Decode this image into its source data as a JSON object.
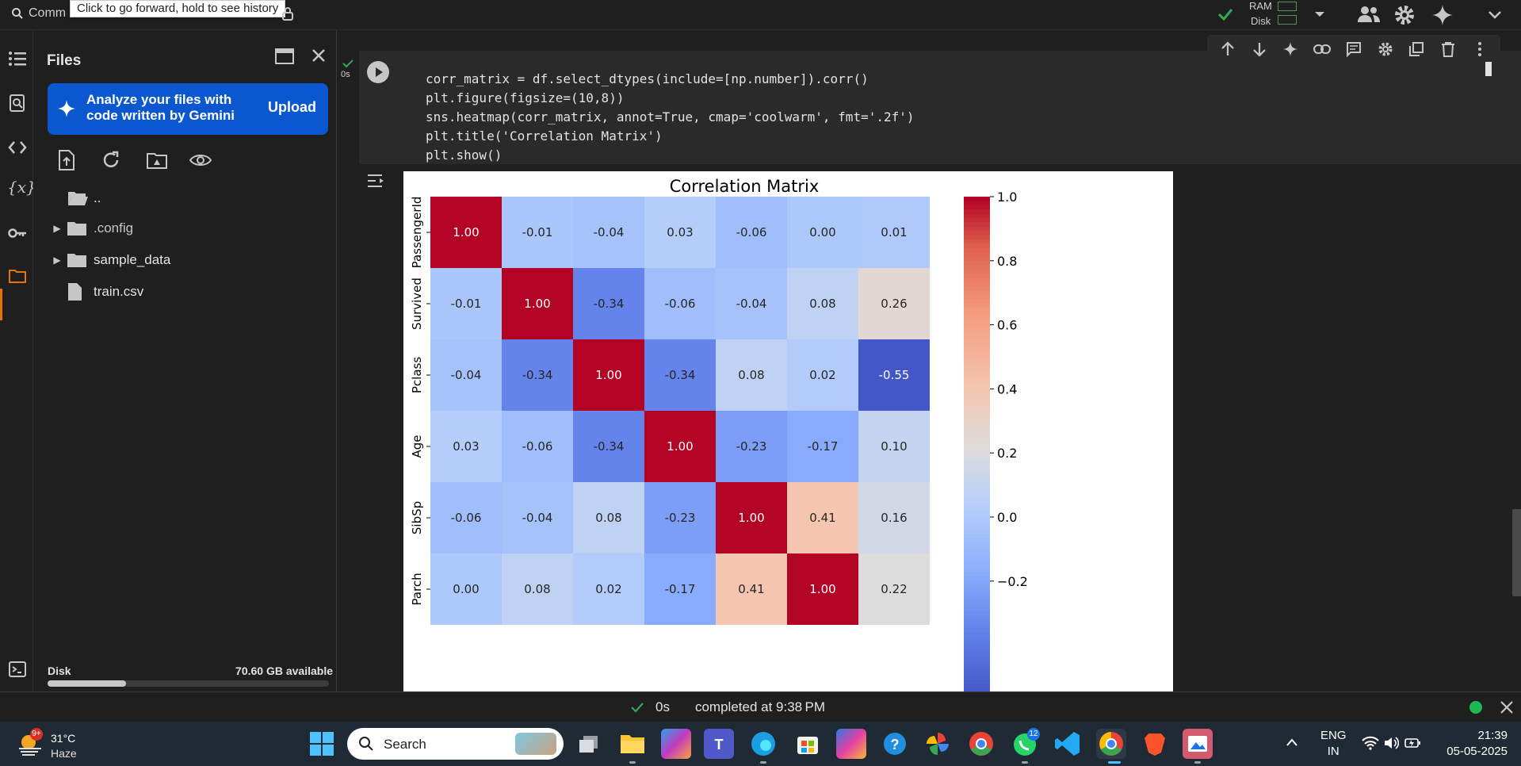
{
  "topbar": {
    "search_label": "Comm",
    "tooltip": "Click to go forward, hold to see history",
    "ram_label": "RAM",
    "disk_label": "Disk"
  },
  "files_panel": {
    "title": "Files",
    "gemini_text": "Analyze your files with code written by Gemini",
    "upload_label": "Upload",
    "tree": [
      {
        "name": "..",
        "type": "folder-open"
      },
      {
        "name": ".config",
        "type": "folder"
      },
      {
        "name": "sample_data",
        "type": "folder"
      },
      {
        "name": "train.csv",
        "type": "file"
      }
    ],
    "disk_label": "Disk",
    "disk_available": "70.60 GB available",
    "disk_used_fraction": 0.28
  },
  "cell": {
    "exec_time": "0s",
    "code_lines": [
      "corr_matrix = df.select_dtypes(include=[np.number]).corr()",
      "plt.figure(figsize=(10,8))",
      "sns.heatmap(corr_matrix, annot=True, cmap='coolwarm', fmt='.2f')",
      "plt.title('Correlation Matrix')",
      "plt.show()"
    ]
  },
  "chart_data": {
    "type": "heatmap",
    "title": "Correlation Matrix",
    "row_labels": [
      "PassengerId",
      "Survived",
      "Pclass",
      "Age",
      "SibSp",
      "Parch"
    ],
    "values": [
      [
        1.0,
        -0.01,
        -0.04,
        0.03,
        -0.06,
        -0.0,
        0.01
      ],
      [
        -0.01,
        1.0,
        -0.34,
        -0.06,
        -0.04,
        0.08,
        0.26
      ],
      [
        -0.04,
        -0.34,
        1.0,
        -0.34,
        0.08,
        0.02,
        -0.55
      ],
      [
        0.03,
        -0.06,
        -0.34,
        1.0,
        -0.23,
        -0.17,
        0.1
      ],
      [
        -0.06,
        -0.04,
        0.08,
        -0.23,
        1.0,
        0.41,
        0.16
      ],
      [
        -0.0,
        0.08,
        0.02,
        -0.17,
        0.41,
        1.0,
        0.22
      ]
    ],
    "colorbar_ticks": [
      "1.0",
      "0.8",
      "0.6",
      "0.4",
      "0.2",
      "0.0",
      "−0.2"
    ],
    "colormap": "coolwarm",
    "vmin": -0.55,
    "vmax": 1.0
  },
  "statusbar": {
    "time": "0s",
    "status": "completed at 9:38 PM"
  },
  "taskbar": {
    "temperature": "31°C",
    "weather": "Haze",
    "weather_badge": "9+",
    "search_placeholder": "Search",
    "lang_top": "ENG",
    "lang_bottom": "IN",
    "time": "21:39",
    "date": "05-05-2025",
    "badge_whatsapp": "12"
  },
  "colors": {
    "accent_orange": "#e8710a",
    "gemini_blue": "#0b57d0",
    "success_green": "#1db954"
  }
}
